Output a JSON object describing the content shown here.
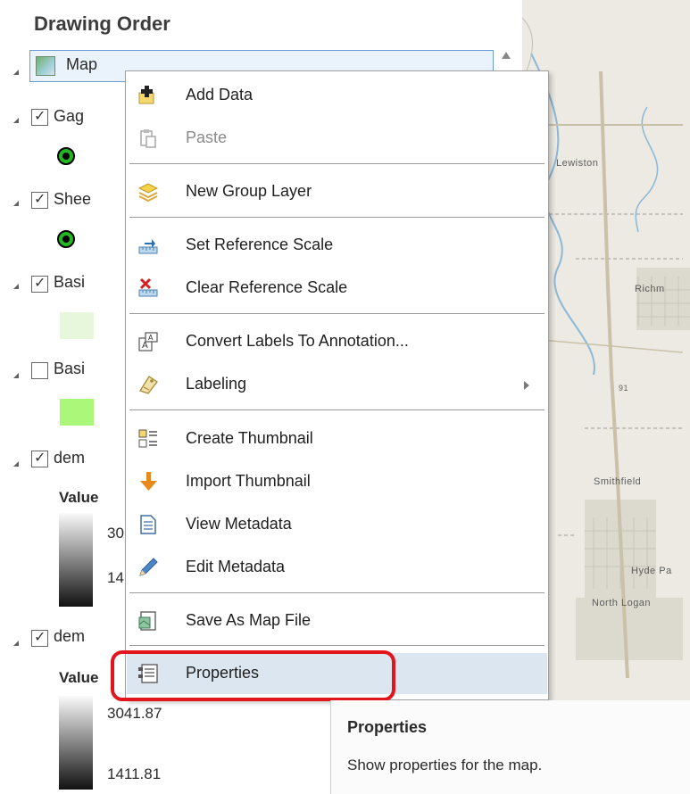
{
  "pane": {
    "title": "Drawing Order",
    "map_node_label": "Map",
    "layers": [
      {
        "label": "Gag",
        "checked": true
      },
      {
        "label": "Shee",
        "checked": true
      },
      {
        "label": "Basi",
        "checked": true
      },
      {
        "label": "Basi",
        "checked": false
      },
      {
        "label": "dem",
        "checked": true
      },
      {
        "label": "dem",
        "checked": true
      }
    ],
    "check_glyph": "✓",
    "value_header_1": "Value",
    "ramp1_high": "30",
    "ramp1_low": "14",
    "value_header_2": "Value",
    "ramp2_high": "3041.87",
    "ramp2_low": "1411.81"
  },
  "colors": {
    "selection_fill": "#eaf3fc",
    "selection_border": "#6a9ed8",
    "highlight_item": "#dbe6f1",
    "callout_red": "#e2141c",
    "point_symbol": "#23b723",
    "basin1_fill": "#e6f7dc",
    "basin2_fill": "#aaf77a"
  },
  "menu": {
    "items": [
      {
        "label": "Add Data",
        "icon": "add-data-icon"
      },
      {
        "label": "Paste",
        "icon": "paste-icon",
        "disabled": true
      },
      {
        "label": "New Group Layer",
        "icon": "group-layer-icon"
      },
      {
        "label": "Set Reference Scale",
        "icon": "set-scale-icon"
      },
      {
        "label": "Clear Reference Scale",
        "icon": "clear-scale-icon"
      },
      {
        "label": "Convert Labels To Annotation...",
        "icon": "annotation-icon"
      },
      {
        "label": "Labeling",
        "icon": "labeling-icon",
        "submenu": true
      },
      {
        "label": "Create Thumbnail",
        "icon": "thumbnail-icon"
      },
      {
        "label": "Import Thumbnail",
        "icon": "import-arrow-icon"
      },
      {
        "label": "View Metadata",
        "icon": "view-metadata-icon"
      },
      {
        "label": "Edit Metadata",
        "icon": "edit-pencil-icon"
      },
      {
        "label": "Save As Map File",
        "icon": "save-map-file-icon"
      },
      {
        "label": "Properties",
        "icon": "properties-icon",
        "highlighted": true
      }
    ]
  },
  "tooltip": {
    "title": "Properties",
    "body": "Show properties for the map."
  },
  "map": {
    "labels": [
      "Lewiston",
      "Richm",
      "Smithfield",
      "Hyde Pa",
      "North Logan",
      "91"
    ]
  }
}
